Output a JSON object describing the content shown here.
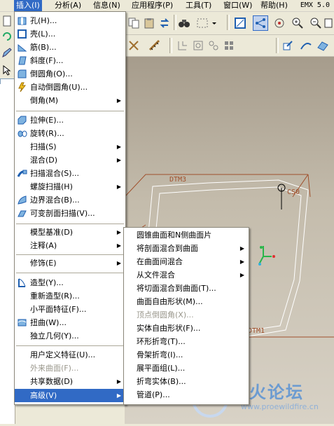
{
  "menubar": {
    "items": [
      {
        "label": "插入(I)"
      },
      {
        "label": "分析(A)"
      },
      {
        "label": "信息(N)"
      },
      {
        "label": "应用程序(P)"
      },
      {
        "label": "工具(T)"
      },
      {
        "label": "窗口(W)"
      },
      {
        "label": "帮助(H)"
      }
    ],
    "product": "EMX 5.0"
  },
  "insert_menu": {
    "items": [
      {
        "label": "孔(H)...",
        "icon": "hole-icon",
        "submenu": false,
        "enabled": true
      },
      {
        "label": "壳(L)...",
        "icon": "shell-icon",
        "submenu": false,
        "enabled": true
      },
      {
        "label": "筋(B)...",
        "icon": "rib-icon",
        "submenu": false,
        "enabled": true
      },
      {
        "label": "斜度(F)...",
        "icon": "draft-icon",
        "submenu": false,
        "enabled": true
      },
      {
        "label": "倒圆角(O)...",
        "icon": "round-icon",
        "submenu": false,
        "enabled": true
      },
      {
        "label": "自动倒圆角(U)...",
        "icon": "auto-round-icon",
        "submenu": false,
        "enabled": true
      },
      {
        "label": "倒角(M)",
        "icon": "",
        "submenu": true,
        "enabled": true
      },
      {
        "label": "拉伸(E)...",
        "icon": "extrude-icon",
        "submenu": false,
        "enabled": true
      },
      {
        "label": "旋转(R)...",
        "icon": "revolve-icon",
        "submenu": false,
        "enabled": true
      },
      {
        "label": "扫描(S)",
        "icon": "",
        "submenu": true,
        "enabled": true
      },
      {
        "label": "混合(D)",
        "icon": "",
        "submenu": true,
        "enabled": true
      },
      {
        "label": "扫描混合(S)...",
        "icon": "swept-blend-icon",
        "submenu": false,
        "enabled": true
      },
      {
        "label": "螺旋扫描(H)",
        "icon": "",
        "submenu": true,
        "enabled": true
      },
      {
        "label": "边界混合(B)...",
        "icon": "boundary-blend-icon",
        "submenu": false,
        "enabled": true
      },
      {
        "label": "可变剖面扫描(V)...",
        "icon": "variable-section-sweep-icon",
        "submenu": false,
        "enabled": true
      },
      {
        "label": "模型基准(D)",
        "icon": "",
        "submenu": true,
        "enabled": true
      },
      {
        "label": "注释(A)",
        "icon": "",
        "submenu": true,
        "enabled": true
      },
      {
        "label": "修饰(E)",
        "icon": "",
        "submenu": true,
        "enabled": true
      },
      {
        "label": "造型(Y)...",
        "icon": "style-icon",
        "submenu": false,
        "enabled": true
      },
      {
        "label": "重新造型(R)...",
        "icon": "",
        "submenu": false,
        "enabled": true
      },
      {
        "label": "小平面特征(F)...",
        "icon": "",
        "submenu": false,
        "enabled": true
      },
      {
        "label": "扭曲(W)...",
        "icon": "warp-icon",
        "submenu": false,
        "enabled": true
      },
      {
        "label": "独立几何(Y)...",
        "icon": "",
        "submenu": false,
        "enabled": true
      },
      {
        "label": "用户定义特征(U)...",
        "icon": "",
        "submenu": false,
        "enabled": true
      },
      {
        "label": "外来曲面(F)...",
        "icon": "",
        "submenu": false,
        "enabled": false
      },
      {
        "label": "共享数据(D)",
        "icon": "",
        "submenu": true,
        "enabled": true
      },
      {
        "label": "高级(V)",
        "icon": "",
        "submenu": true,
        "enabled": true,
        "highlighted": true
      }
    ]
  },
  "advanced_menu": {
    "items": [
      {
        "label": "圆锥曲面和N侧曲面片",
        "submenu": false,
        "enabled": true
      },
      {
        "label": "将剖面混合到曲面",
        "submenu": true,
        "enabled": true
      },
      {
        "label": "在曲面间混合",
        "submenu": true,
        "enabled": true
      },
      {
        "label": "从文件混合",
        "submenu": true,
        "enabled": true
      },
      {
        "label": "将切面混合到曲面(T)...",
        "submenu": false,
        "enabled": true
      },
      {
        "label": "曲面自由形状(M)...",
        "submenu": false,
        "enabled": true
      },
      {
        "label": "顶点倒圆角(X)...",
        "submenu": false,
        "enabled": false
      },
      {
        "label": "实体自由形状(F)...",
        "submenu": false,
        "enabled": true
      },
      {
        "label": "环形折弯(T)...",
        "submenu": false,
        "enabled": true
      },
      {
        "label": "骨架折弯(I)...",
        "submenu": false,
        "enabled": true
      },
      {
        "label": "展平面组(L)...",
        "submenu": false,
        "enabled": true
      },
      {
        "label": "折弯实体(B)...",
        "submenu": false,
        "enabled": true
      },
      {
        "label": "管道(P)...",
        "submenu": false,
        "enabled": true
      }
    ]
  },
  "viewport": {
    "datum_labels": [
      "DTM3",
      "CS0",
      "DTM1"
    ]
  },
  "watermark": {
    "text": "野火论坛",
    "url": "www.proewildfire.cn"
  },
  "colors": {
    "highlight": "#316ac5",
    "menu_bg": "#ffffff",
    "chrome": "#ece9d8",
    "datum": "#a0502c"
  }
}
